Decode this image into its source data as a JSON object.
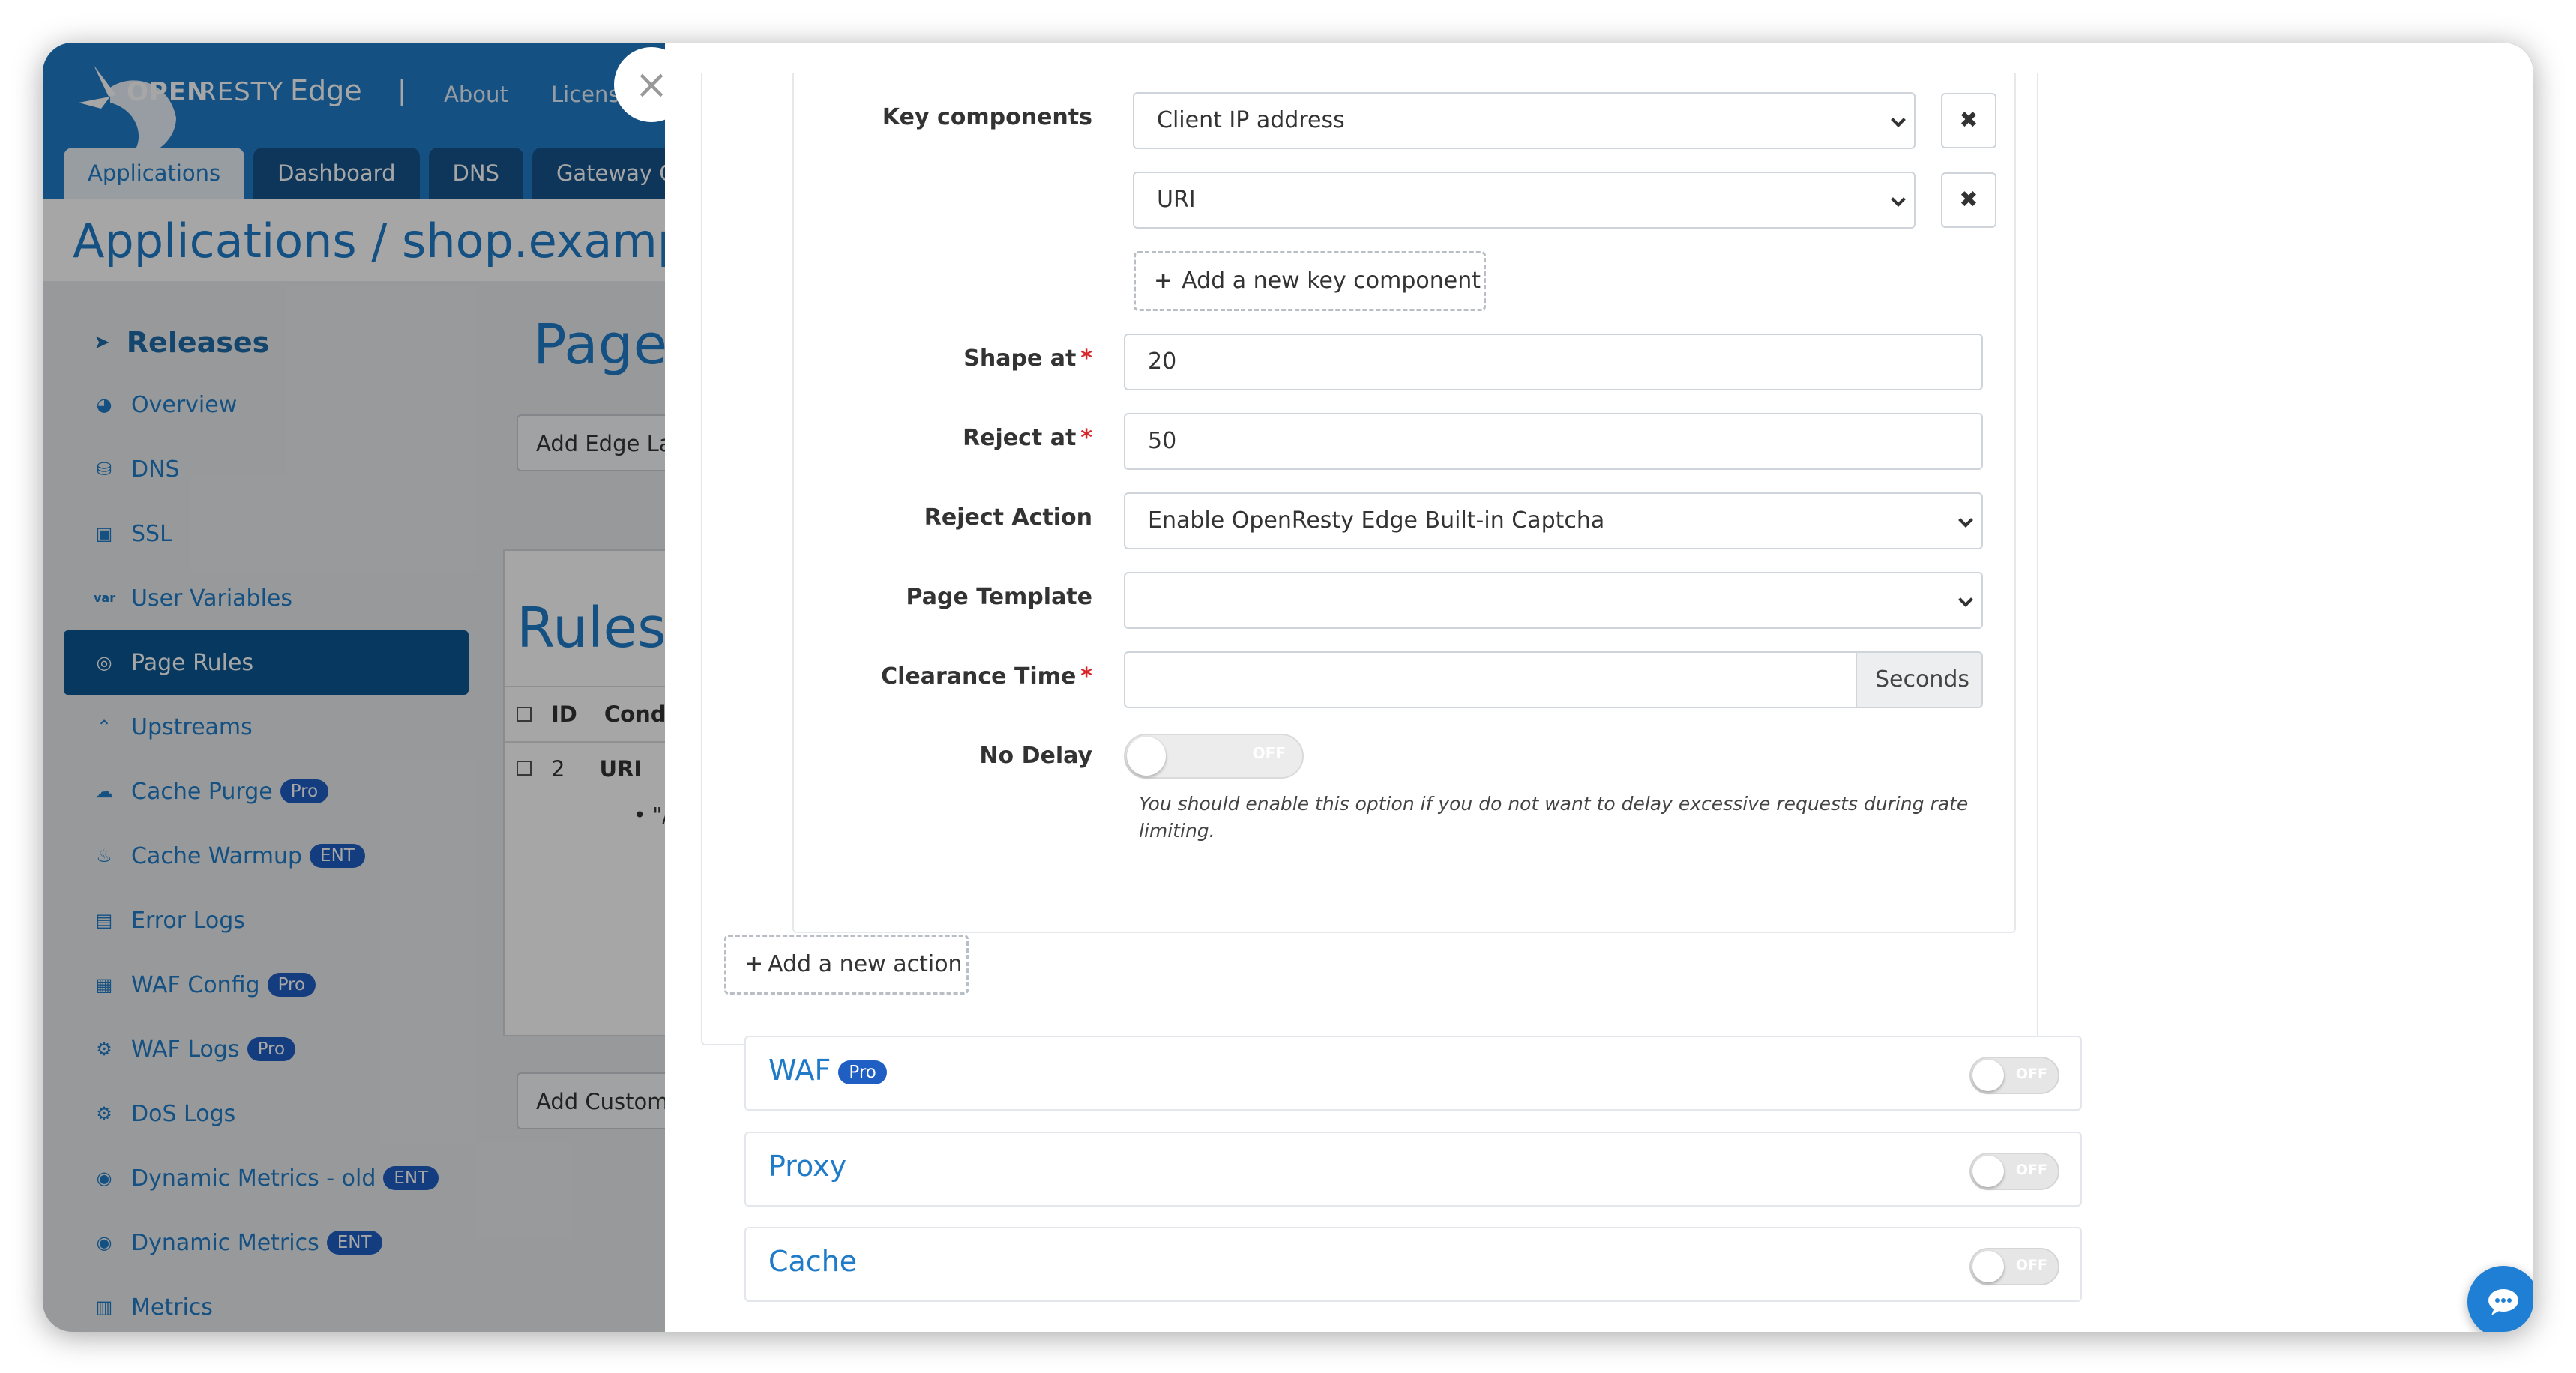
{
  "header": {
    "logo_open": "OPEN",
    "logo_resty": "RESTY",
    "logo_edge": "Edge",
    "separator": "|",
    "links": [
      "About",
      "Licens"
    ]
  },
  "tabs": [
    "Applications",
    "Dashboard",
    "DNS",
    "Gateway Cl"
  ],
  "breadcrumb": "Applications / shop.examp",
  "sidebar": {
    "heading": "Releases",
    "items": [
      {
        "label": "Overview",
        "icon": "dashboard-icon"
      },
      {
        "label": "DNS",
        "icon": "dns-icon"
      },
      {
        "label": "SSL",
        "icon": "certificate-icon"
      },
      {
        "label": "User Variables",
        "icon": "var-icon"
      },
      {
        "label": "Page Rules",
        "icon": "rules-icon"
      },
      {
        "label": "Upstreams",
        "icon": "upstream-icon"
      },
      {
        "label": "Cache Purge",
        "icon": "cloud-icon",
        "badge": "Pro"
      },
      {
        "label": "Cache Warmup",
        "icon": "fire-icon",
        "badge": "ENT"
      },
      {
        "label": "Error Logs",
        "icon": "log-icon"
      },
      {
        "label": "WAF Config",
        "icon": "table-icon",
        "badge": "Pro"
      },
      {
        "label": "WAF Logs",
        "icon": "waf-log-icon",
        "badge": "Pro"
      },
      {
        "label": "DoS Logs",
        "icon": "dos-log-icon"
      },
      {
        "label": "Dynamic Metrics - old",
        "icon": "metrics-icon",
        "badge": "ENT"
      },
      {
        "label": "Dynamic Metrics",
        "icon": "metrics-icon",
        "badge": "ENT"
      },
      {
        "label": "Metrics",
        "icon": "bar-chart-icon"
      }
    ]
  },
  "main": {
    "title": "Page",
    "add_edge_btn": "Add Edge La",
    "rules_title": "Rules",
    "table_headers": [
      "ID",
      "Cond"
    ],
    "row": {
      "id": "2",
      "cond": "URI",
      "detail": "\"/cl"
    },
    "add_custom_btn": "Add Custom"
  },
  "modal": {
    "close": "×",
    "key_components_label": "Key components",
    "key_components": [
      "Client IP address",
      "URI"
    ],
    "remove_glyph": "✖",
    "add_key_component": "Add a new key component",
    "shape_at_label": "Shape at",
    "shape_at_value": "20",
    "reject_at_label": "Reject at",
    "reject_at_value": "50",
    "reject_action_label": "Reject Action",
    "reject_action_value": "Enable OpenResty Edge Built-in Captcha",
    "page_template_label": "Page Template",
    "page_template_value": "",
    "clearance_time_label": "Clearance Time",
    "clearance_time_value": "",
    "clearance_unit": "Seconds",
    "no_delay_label": "No Delay",
    "no_delay_state": "OFF",
    "no_delay_hint": "You should enable this option if you do not want to delay excessive requests during rate limiting.",
    "required_mark": "*",
    "add_action": "Add a new action",
    "sections": [
      {
        "title": "WAF",
        "badge": "Pro",
        "state": "OFF"
      },
      {
        "title": "Proxy",
        "state": "OFF"
      },
      {
        "title": "Cache",
        "state": "OFF"
      }
    ]
  },
  "colors": {
    "accent": "#1f7bc7",
    "header": "#1f7bc7",
    "sidebar_active": "#0c5692",
    "required": "#d9262a",
    "badge": "#1f5fc4"
  }
}
